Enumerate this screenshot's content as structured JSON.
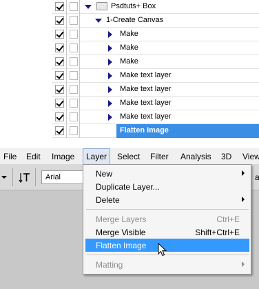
{
  "actions_panel": {
    "rows": [
      {
        "label": "Psdtuts+ Box",
        "kind": "set"
      },
      {
        "label": "1-Create Canvas",
        "kind": "action"
      },
      {
        "label": "Make",
        "kind": "step"
      },
      {
        "label": "Make",
        "kind": "step"
      },
      {
        "label": "Make",
        "kind": "step"
      },
      {
        "label": "Make text layer",
        "kind": "step"
      },
      {
        "label": "Make text layer",
        "kind": "step"
      },
      {
        "label": "Make text layer",
        "kind": "step"
      },
      {
        "label": "Make text layer",
        "kind": "step"
      },
      {
        "label": "Flatten Image",
        "kind": "step-selected"
      }
    ]
  },
  "menubar": {
    "items": [
      "File",
      "Edit",
      "Image",
      "Layer",
      "Select",
      "Filter",
      "Analysis",
      "3D",
      "View"
    ],
    "active": "Layer"
  },
  "options_bar": {
    "text_tool_icon": "text-orientation-icon",
    "font_value": "Arial",
    "partial_text": "a"
  },
  "layer_menu": {
    "items": [
      {
        "label": "New",
        "shortcut": "",
        "submenu": true,
        "enabled": true
      },
      {
        "label": "Duplicate Layer...",
        "shortcut": "",
        "submenu": false,
        "enabled": true
      },
      {
        "label": "Delete",
        "shortcut": "",
        "submenu": true,
        "enabled": true
      },
      {
        "label": "Merge Layers",
        "shortcut": "Ctrl+E",
        "submenu": false,
        "enabled": false
      },
      {
        "label": "Merge Visible",
        "shortcut": "Shift+Ctrl+E",
        "submenu": false,
        "enabled": true
      },
      {
        "label": "Flatten Image",
        "shortcut": "",
        "submenu": false,
        "enabled": true,
        "highlighted": true
      },
      {
        "label": "Matting",
        "shortcut": "",
        "submenu": true,
        "enabled": false
      }
    ]
  },
  "colors": {
    "selection": "#3399ff",
    "actions_selection": "#3a8ee6",
    "panel_bg": "#d9d9d9"
  }
}
